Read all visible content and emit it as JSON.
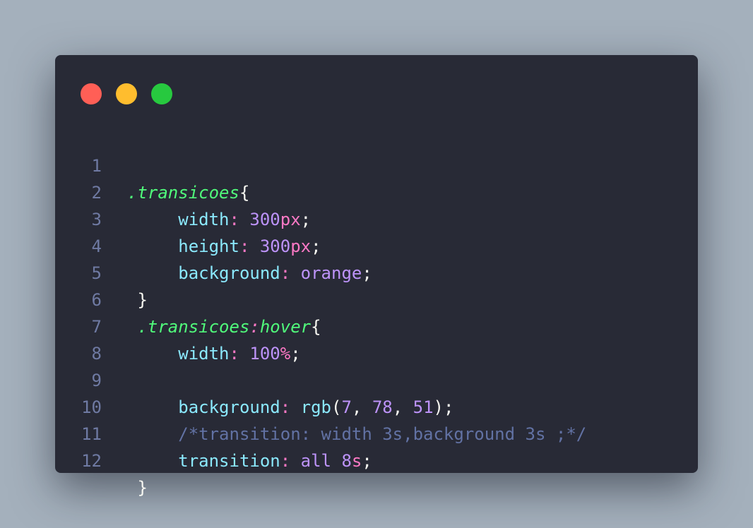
{
  "window": {
    "controls": [
      {
        "name": "close",
        "color": "#ff5f56"
      },
      {
        "name": "minimize",
        "color": "#ffbd2e"
      },
      {
        "name": "maximize",
        "color": "#27c93f"
      }
    ]
  },
  "code": {
    "language": "css",
    "line_numbers": [
      "1",
      "2",
      "3",
      "4",
      "5",
      "6",
      "7",
      "8",
      "9",
      "10",
      "11",
      "12"
    ],
    "l1": {
      "selector": ".transicoes",
      "brace": "{"
    },
    "l2": {
      "prop": "width",
      "colon": ":",
      "num": "300",
      "unit": "px",
      "semi": ";"
    },
    "l3": {
      "prop": "height",
      "colon": ":",
      "num": "300",
      "unit": "px",
      "semi": ";"
    },
    "l4": {
      "prop": "background",
      "colon": ":",
      "value": "orange",
      "semi": ";"
    },
    "l5": {
      "brace": "}"
    },
    "l6": {
      "selector": ".transicoes",
      "pseudo_colon": ":",
      "pseudo": "hover",
      "brace": "{"
    },
    "l7": {
      "prop": "width",
      "colon": ":",
      "num": "100",
      "unit": "%",
      "semi": ";"
    },
    "l8": {},
    "l9": {
      "prop": "background",
      "colon": ":",
      "func": "rgb",
      "open": "(",
      "a": "7",
      "c1": ", ",
      "b": "78",
      "c2": ", ",
      "c": "51",
      "close": ")",
      "semi": ";"
    },
    "l10": {
      "comment": "/*transition: width 3s,background 3s ;*/"
    },
    "l11": {
      "prop": "transition",
      "colon": ":",
      "value": "all",
      "num": "8",
      "unit": "s",
      "semi": ";"
    },
    "l12": {
      "brace": "}"
    }
  }
}
